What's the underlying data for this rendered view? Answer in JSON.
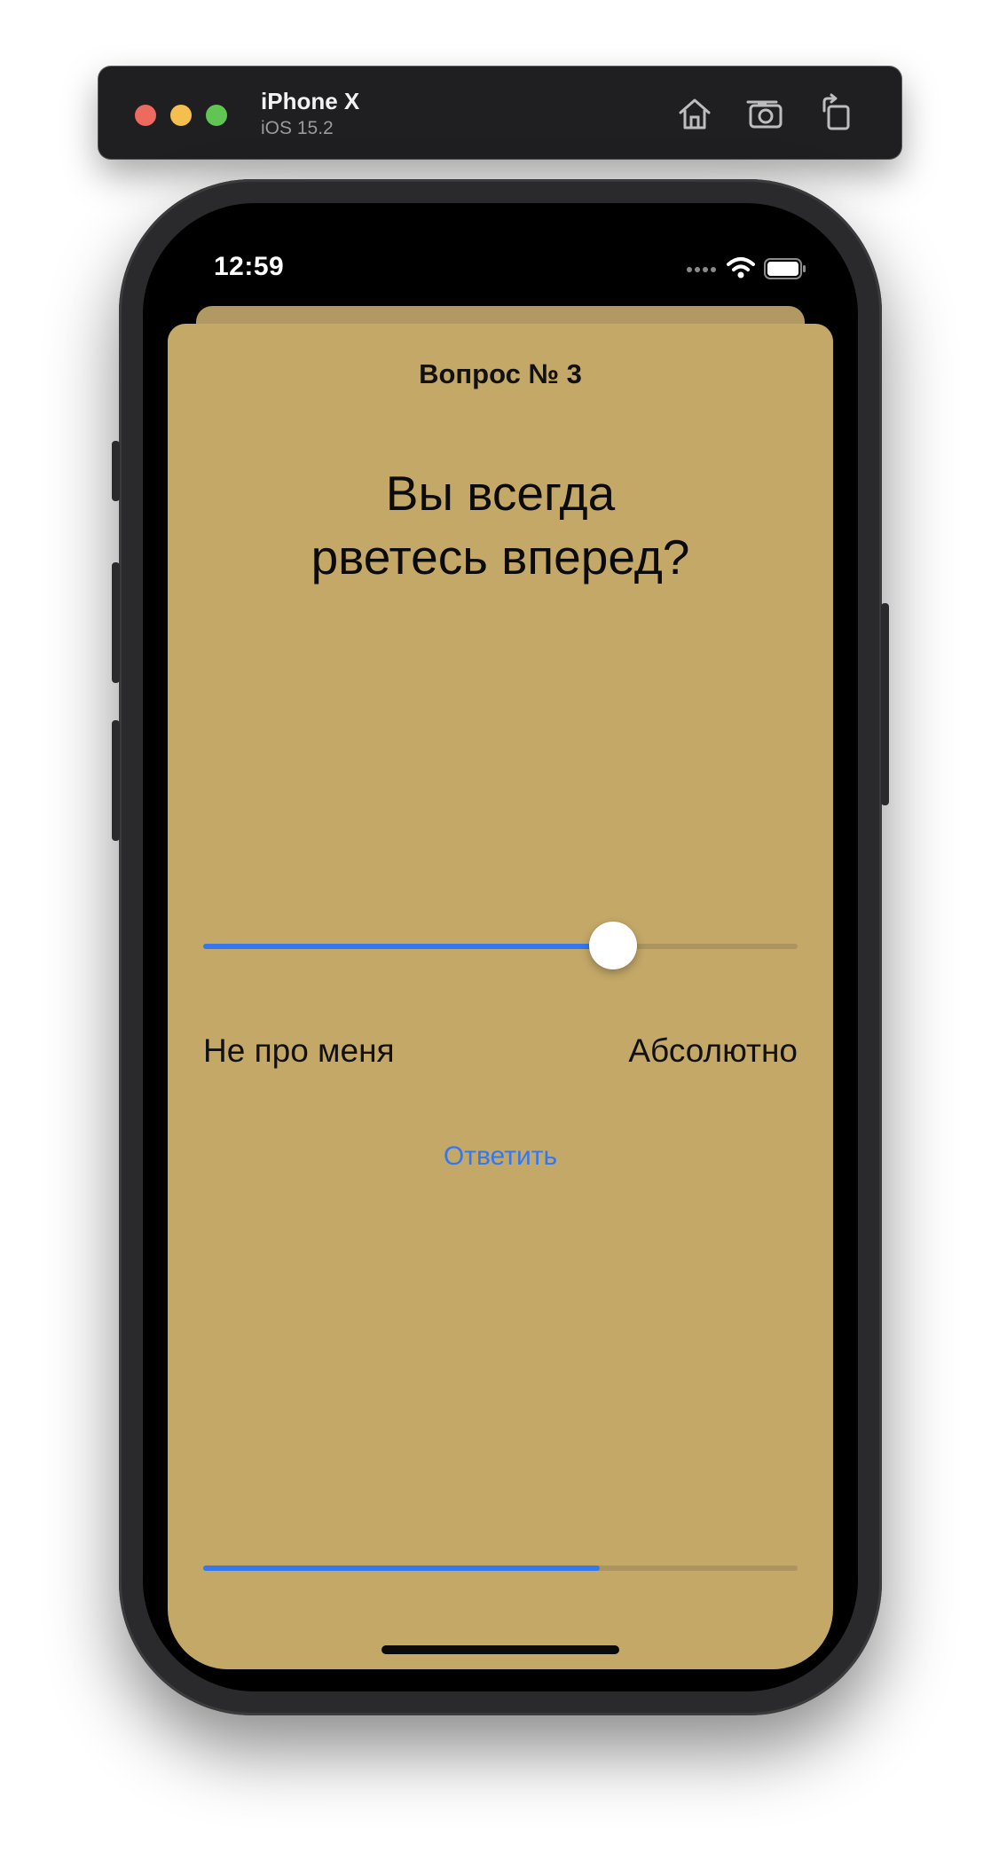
{
  "simulator": {
    "device_name": "iPhone X",
    "os_version": "iOS 15.2",
    "toolbar_icons": [
      "home-icon",
      "screenshot-icon",
      "rotate-icon"
    ]
  },
  "status_bar": {
    "time": "12:59",
    "icons": [
      "cellular-icon",
      "wifi-icon",
      "battery-icon"
    ]
  },
  "question": {
    "number_label": "Вопрос № 3",
    "text_line1": "Вы всегда",
    "text_line2": "рветесь вперед?"
  },
  "answer_slider": {
    "value_fraction": 0.69,
    "min_label": "Не про меня",
    "max_label": "Абсолютно"
  },
  "answer_button_label": "Ответить",
  "progress": {
    "value_fraction": 0.667
  },
  "colors": {
    "card_background": "#c4a868",
    "accent": "#3478f0",
    "track": "#ab9460"
  }
}
